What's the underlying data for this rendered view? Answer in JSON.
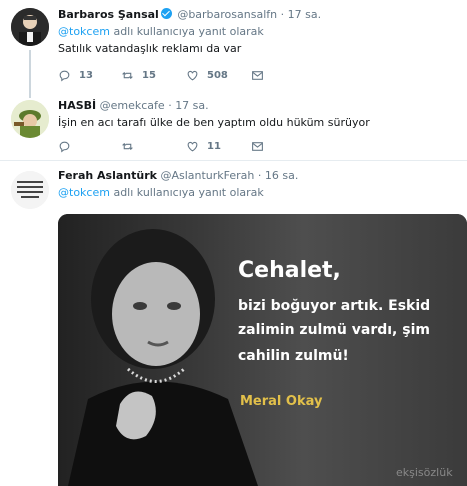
{
  "tweets": [
    {
      "name": "Barbaros Şansal",
      "handle": "@barbarosansalfn",
      "time": "17 sa.",
      "reply_to": "@tokcem",
      "reply_suffix": " adlı kullanıcıya yanıt olarak",
      "text": "Satılık vatandaşlık reklamı da var",
      "replies": "13",
      "retweets": "15",
      "likes": "508",
      "verified": true
    },
    {
      "name": "HASBİ",
      "handle": "@emekcafe",
      "time": "17 sa.",
      "text": "İşin en acı tarafı ülke de ben yaptım oldu hüküm sürüyor",
      "replies": "",
      "retweets": "",
      "likes": "11"
    },
    {
      "name": "Ferah Aslantürk",
      "handle": "@AslanturkFerah",
      "time": "16 sa.",
      "reply_to": "@tokcem",
      "reply_suffix": " adlı kullanıcıya yanıt olarak",
      "media": {
        "headline": "Cehalet,",
        "line1": "bizi boğuyor artık. Eskid",
        "line2": "zalimin zulmü vardı, şim",
        "line3": "cahilin zulmü!",
        "author": "Meral Okay",
        "watermark": "ekşisözlük"
      }
    }
  ],
  "separator_dot": "·",
  "icons": {
    "reply": "reply-icon",
    "retweet": "retweet-icon",
    "like": "heart-icon",
    "dm": "envelope-icon",
    "verified": "verified-badge-icon"
  },
  "colors": {
    "accent": "#1da1f2",
    "muted": "#657786",
    "text": "#14171a"
  }
}
